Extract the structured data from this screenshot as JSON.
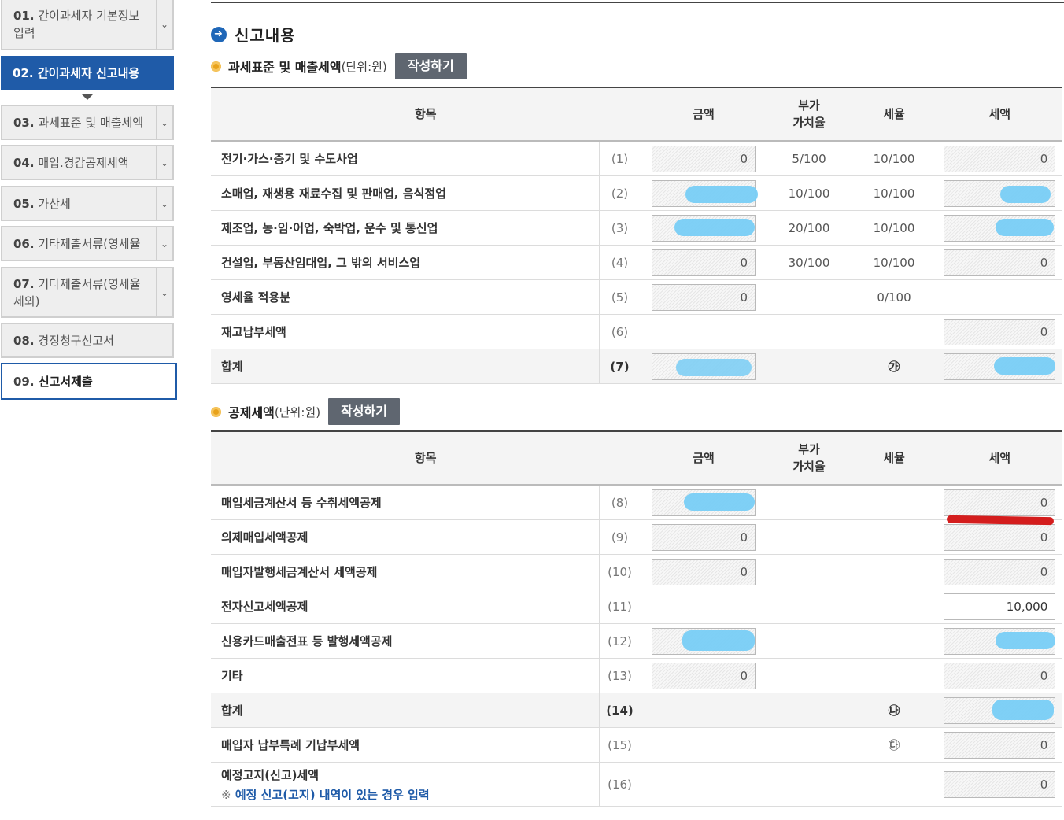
{
  "sidebar": {
    "items": [
      {
        "num": "01.",
        "label": "간이과세자 기본정보 입력",
        "chevron": "chevron-down-icon"
      },
      {
        "num": "02.",
        "label": "간이과세자 신고내용",
        "chevron": ""
      },
      {
        "num": "03.",
        "label": "과세표준 및 매출세액",
        "chevron": "chevron-down-icon"
      },
      {
        "num": "04.",
        "label": "매입.경감공제세액",
        "chevron": "chevron-down-icon"
      },
      {
        "num": "05.",
        "label": "가산세",
        "chevron": "chevron-down-icon"
      },
      {
        "num": "06.",
        "label": "기타제출서류(영세율",
        "chevron": "chevron-down-icon"
      },
      {
        "num": "07.",
        "label": "기타제출서류(영세율 제외)",
        "chevron": "chevron-down-icon"
      },
      {
        "num": "08.",
        "label": "경정청구신고서",
        "chevron": ""
      },
      {
        "num": "09.",
        "label": "신고서제출",
        "chevron": ""
      }
    ]
  },
  "main": {
    "title": "신고내용",
    "section1": {
      "title": "과세표준 및 매출세액",
      "unit": "(단위:원)",
      "button": "작성하기",
      "headers": {
        "item": "항목",
        "amount": "금액",
        "vat_rate": "부가\n가치율",
        "tax_rate": "세율",
        "tax": "세액"
      },
      "rows": [
        {
          "item": "전기·가스·증기 및 수도사업",
          "no": "(1)",
          "amount": "0",
          "vat_rate": "5/100",
          "tax_rate": "10/100",
          "tax": "0"
        },
        {
          "item": "소매업, 재생용 재료수집 및 판매업, 음식점업",
          "no": "(2)",
          "amount": "",
          "vat_rate": "10/100",
          "tax_rate": "10/100",
          "tax": ""
        },
        {
          "item": "제조업, 농·임·어업, 숙박업, 운수 및 통신업",
          "no": "(3)",
          "amount": "",
          "vat_rate": "20/100",
          "tax_rate": "10/100",
          "tax": ""
        },
        {
          "item": "건설업, 부동산임대업, 그 밖의 서비스업",
          "no": "(4)",
          "amount": "0",
          "vat_rate": "30/100",
          "tax_rate": "10/100",
          "tax": "0"
        },
        {
          "item": "영세율 적용분",
          "no": "(5)",
          "amount": "0",
          "vat_rate": "",
          "tax_rate": "0/100",
          "tax": ""
        },
        {
          "item": "재고납부세액",
          "no": "(6)",
          "amount": "",
          "vat_rate": "",
          "tax_rate": "",
          "tax": "0"
        },
        {
          "item": "합계",
          "no": "(7)",
          "amount": "",
          "vat_rate": "",
          "tax_rate": "㉮",
          "tax": ""
        }
      ]
    },
    "section2": {
      "title": "공제세액",
      "unit": "(단위:원)",
      "button": "작성하기",
      "headers": {
        "item": "항목",
        "amount": "금액",
        "vat_rate": "부가\n가치율",
        "tax_rate": "세율",
        "tax": "세액"
      },
      "rows": [
        {
          "item": "매입세금계산서 등 수취세액공제",
          "no": "(8)",
          "amount": "",
          "tax_rate": "",
          "tax": "0"
        },
        {
          "item": "의제매입세액공제",
          "no": "(9)",
          "amount": "0",
          "tax_rate": "",
          "tax": "0"
        },
        {
          "item": "매입자발행세금계산서 세액공제",
          "no": "(10)",
          "amount": "0",
          "tax_rate": "",
          "tax": "0"
        },
        {
          "item": "전자신고세액공제",
          "no": "(11)",
          "amount": "",
          "tax_rate": "",
          "tax": "10,000"
        },
        {
          "item": "신용카드매출전표 등 발행세액공제",
          "no": "(12)",
          "amount": "",
          "tax_rate": "",
          "tax": ""
        },
        {
          "item": "기타",
          "no": "(13)",
          "amount": "0",
          "tax_rate": "",
          "tax": "0"
        },
        {
          "item": "합계",
          "no": "(14)",
          "amount": "",
          "tax_rate": "㉯",
          "tax": ""
        },
        {
          "item": "매입자 납부특례 기납부세액",
          "no": "(15)",
          "amount": "",
          "tax_rate": "㉰",
          "tax": "0"
        },
        {
          "item": "예정고지(신고)세액",
          "no": "(16)",
          "amount": "",
          "tax_rate": "",
          "tax": "0",
          "note_mark": "※",
          "note": "예정 신고(고지) 내역이 있는 경우 입력"
        }
      ]
    }
  },
  "colors": {
    "brand_blue": "#1f5ba8",
    "button_gray": "#5f6670",
    "orange_bullet": "#e8a21b",
    "redaction_blue": "#78cdf5",
    "red_mark": "#d41d1d"
  }
}
